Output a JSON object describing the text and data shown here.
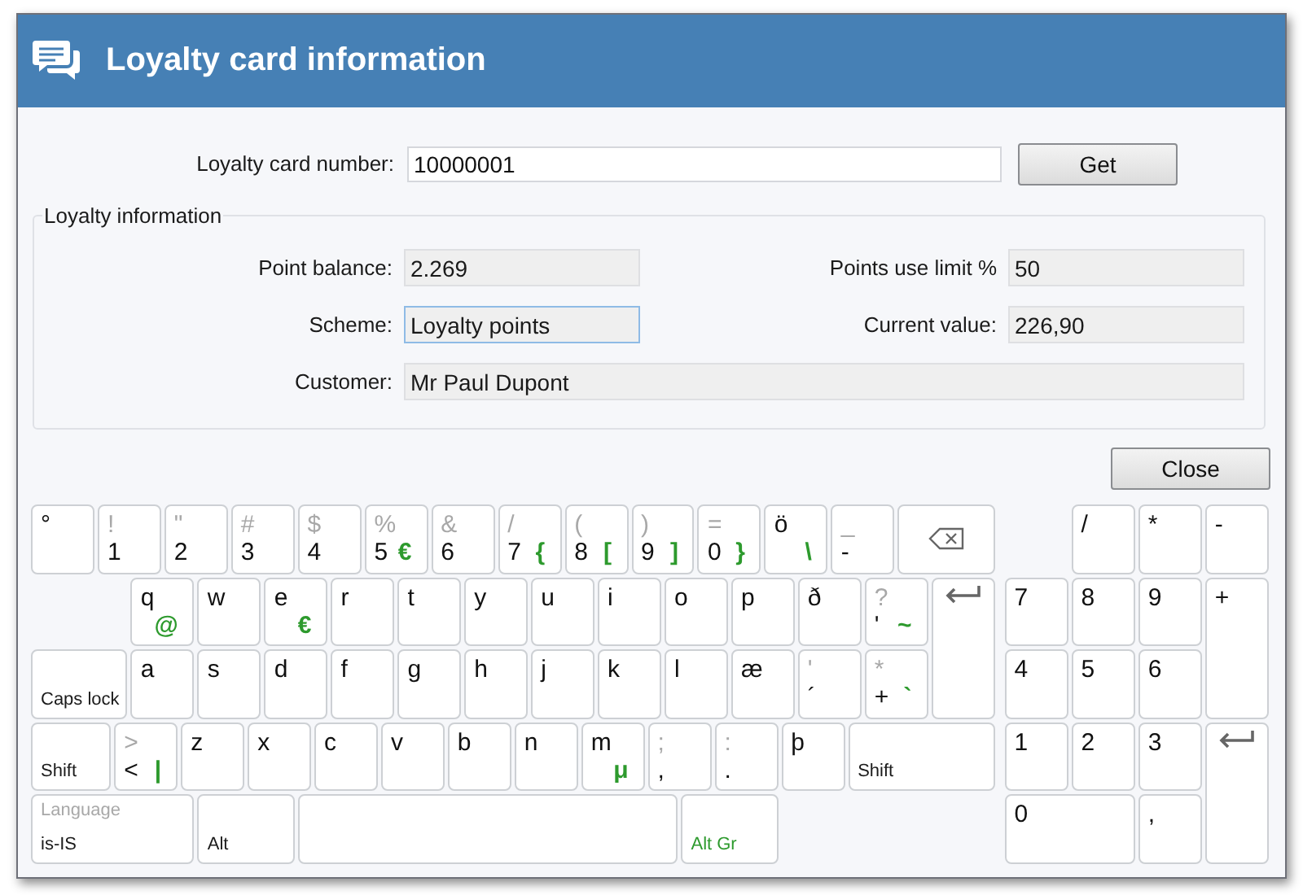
{
  "window": {
    "title": "Loyalty card information"
  },
  "card_number": {
    "label": "Loyalty card number:",
    "value": "10000001",
    "button": "Get"
  },
  "loyalty_info": {
    "title": "Loyalty information",
    "fields": [
      {
        "label": "Point balance:",
        "value": "2.269",
        "focused": false,
        "kind": "short"
      },
      {
        "label": "Points use limit %",
        "value": "50",
        "focused": false,
        "kind": "short"
      },
      {
        "label": "Scheme:",
        "value": "Loyalty points",
        "focused": true,
        "kind": "short"
      },
      {
        "label": "Current value:",
        "value": "226,90",
        "focused": false,
        "kind": "short"
      },
      {
        "label": "Customer:",
        "value": "Mr Paul Dupont",
        "focused": false,
        "kind": "wide"
      }
    ]
  },
  "close_button": "Close",
  "keyboard": {
    "rows": [
      {
        "keys": [
          {
            "kind": "letter",
            "base": "°"
          },
          {
            "kind": "char",
            "shift": "!",
            "base": "1"
          },
          {
            "kind": "char",
            "shift": "\"",
            "base": "2"
          },
          {
            "kind": "char",
            "shift": "#",
            "base": "3"
          },
          {
            "kind": "char",
            "shift": "$",
            "base": "4"
          },
          {
            "kind": "char",
            "shift": "%",
            "base": "5",
            "altgr": "€"
          },
          {
            "kind": "char",
            "shift": "&",
            "base": "6"
          },
          {
            "kind": "char",
            "shift": "/",
            "base": "7",
            "altgr": "{"
          },
          {
            "kind": "char",
            "shift": "(",
            "base": "8",
            "altgr": "["
          },
          {
            "kind": "char",
            "shift": ")",
            "base": "9",
            "altgr": "]"
          },
          {
            "kind": "char",
            "shift": "=",
            "base": "0",
            "altgr": "}"
          },
          {
            "kind": "letter",
            "base": "ö",
            "altgr": "\\"
          },
          {
            "kind": "char",
            "shift": "_",
            "base": "-"
          },
          {
            "kind": "backspace"
          }
        ]
      },
      {
        "keys": [
          {
            "kind": "letter",
            "base": "q",
            "altgr": "@"
          },
          {
            "kind": "letter",
            "base": "w"
          },
          {
            "kind": "letter",
            "base": "e",
            "altgr": "€"
          },
          {
            "kind": "letter",
            "base": "r"
          },
          {
            "kind": "letter",
            "base": "t"
          },
          {
            "kind": "letter",
            "base": "y"
          },
          {
            "kind": "letter",
            "base": "u"
          },
          {
            "kind": "letter",
            "base": "i"
          },
          {
            "kind": "letter",
            "base": "o"
          },
          {
            "kind": "letter",
            "base": "p"
          },
          {
            "kind": "letter",
            "base": "ð"
          },
          {
            "kind": "char",
            "shift": "?",
            "base": "'",
            "altgr": "~"
          },
          {
            "kind": "enter"
          }
        ]
      },
      {
        "keys": [
          {
            "kind": "caps",
            "label": "Caps lock"
          },
          {
            "kind": "letter",
            "base": "a"
          },
          {
            "kind": "letter",
            "base": "s"
          },
          {
            "kind": "letter",
            "base": "d"
          },
          {
            "kind": "letter",
            "base": "f"
          },
          {
            "kind": "letter",
            "base": "g"
          },
          {
            "kind": "letter",
            "base": "h"
          },
          {
            "kind": "letter",
            "base": "j"
          },
          {
            "kind": "letter",
            "base": "k"
          },
          {
            "kind": "letter",
            "base": "l"
          },
          {
            "kind": "letter",
            "base": "æ"
          },
          {
            "kind": "char",
            "shift": "'",
            "base": "´"
          },
          {
            "kind": "char",
            "shift": "*",
            "base": "+",
            "altgr": "`"
          }
        ]
      },
      {
        "keys": [
          {
            "kind": "shift_left",
            "label": "Shift"
          },
          {
            "kind": "char",
            "shift": ">",
            "base": "<",
            "altgr": "|"
          },
          {
            "kind": "letter",
            "base": "z"
          },
          {
            "kind": "letter",
            "base": "x"
          },
          {
            "kind": "letter",
            "base": "c"
          },
          {
            "kind": "letter",
            "base": "v"
          },
          {
            "kind": "letter",
            "base": "b"
          },
          {
            "kind": "letter",
            "base": "n"
          },
          {
            "kind": "letter",
            "base": "m",
            "altgr": "μ"
          },
          {
            "kind": "char",
            "shift": ";",
            "base": ","
          },
          {
            "kind": "char",
            "shift": ":",
            "base": "."
          },
          {
            "kind": "letter",
            "base": "þ"
          },
          {
            "kind": "shift_right",
            "label": "Shift"
          }
        ]
      },
      {
        "keys": [
          {
            "kind": "language",
            "caption": "Language",
            "label": "is-IS"
          },
          {
            "kind": "alt",
            "label": "Alt"
          },
          {
            "kind": "space"
          },
          {
            "kind": "altgr",
            "label": "Alt Gr"
          }
        ]
      }
    ],
    "numpad": [
      {
        "keys": [
          {
            "kind": "letter",
            "base": "/"
          },
          {
            "kind": "letter",
            "base": "*"
          },
          {
            "kind": "letter",
            "base": "-"
          }
        ]
      },
      {
        "keys": [
          {
            "kind": "letter",
            "base": "7"
          },
          {
            "kind": "letter",
            "base": "8"
          },
          {
            "kind": "letter",
            "base": "9"
          },
          {
            "kind": "tall",
            "base": "+"
          }
        ]
      },
      {
        "keys": [
          {
            "kind": "letter",
            "base": "4"
          },
          {
            "kind": "letter",
            "base": "5"
          },
          {
            "kind": "letter",
            "base": "6"
          }
        ]
      },
      {
        "keys": [
          {
            "kind": "letter",
            "base": "1"
          },
          {
            "kind": "letter",
            "base": "2"
          },
          {
            "kind": "letter",
            "base": "3"
          },
          {
            "kind": "enter"
          }
        ]
      },
      {
        "keys": [
          {
            "kind": "wide",
            "base": "0"
          },
          {
            "kind": "letter",
            "base": ","
          }
        ]
      }
    ]
  }
}
